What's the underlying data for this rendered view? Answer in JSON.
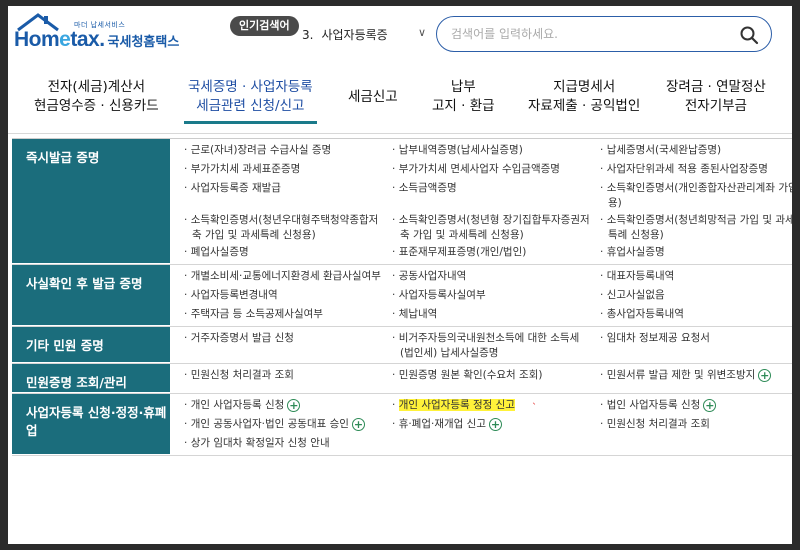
{
  "header": {
    "logo_tagline": "마더 납세서비스",
    "logo_home": "Hom",
    "logo_e": "e",
    "logo_tax": "tax.",
    "logo_kor": "국세청홈택스",
    "popular_label": "인기검색어",
    "popular_rank": "3.",
    "popular_term": "사업자등록증",
    "search_placeholder": "검색어를 입력하세요."
  },
  "nav": [
    {
      "line1": "전자(세금)계산서",
      "line2": "현금영수증 · 신용카드"
    },
    {
      "line1": "국세증명 · 사업자등록",
      "line2": "세금관련 신청/신고"
    },
    {
      "line1": "세금신고",
      "line2": ""
    },
    {
      "line1": "납부",
      "line2": "고지 · 환급"
    },
    {
      "line1": "지급명세서",
      "line2": "자료제출 · 공익법인"
    },
    {
      "line1": "장려금 · 연말정산",
      "line2": "전자기부금"
    }
  ],
  "sections": [
    {
      "title": "즉시발급 증명",
      "items": [
        "근로(자녀)장려금 수급사실 증명",
        "납부내역증명(납세사실증명)",
        "납세증명서(국세완납증명)",
        "부가가치세 과세표준증명",
        "부가가치세 면세사업자 수입금액증명",
        "사업자단위과세 적용 종된사업장증명",
        "사업자등록증 재발급",
        "소득금액증명",
        "소득확인증명서(개인종합자산관리계좌 가입용)",
        "소득확인증명서(청년우대형주택청약종합저축 가입 및 과세특례 신청용)",
        "소득확인증명서(청년형 장기집합투자증권저축 가입 및 과세특례 신청용)",
        "소득확인증명서(청년희망적금 가입 및 과세특례 신청용)",
        "폐업사실증명",
        "표준재무제표증명(개인/법인)",
        "휴업사실증명"
      ]
    },
    {
      "title": "사실확인 후 발급 증명",
      "items": [
        "개별소비세·교통에너지환경세 환급사실여부",
        "공동사업자내역",
        "대표자등록내역",
        "사업자등록변경내역",
        "사업자등록사실여부",
        "신고사실없음",
        "주택자금 등 소득공제사실여부",
        "체납내역",
        "총사업자등록내역"
      ]
    },
    {
      "title": "기타 민원 증명",
      "items": [
        "거주자증명서 발급 신청",
        "비거주자등의국내원천소득에 대한 소득세(법인세) 납세사실증명",
        "임대차 정보제공 요청서"
      ]
    },
    {
      "title": "민원증명 조회/관리",
      "items": [
        "민원신청 처리결과 조회",
        "민원증명 원본 확인(수요처 조회)",
        "민원서류 발급 제한 및 위변조방지"
      ]
    },
    {
      "title": "사업자등록 신청·정정·휴폐업",
      "items": [
        "개인 사업자등록 신청",
        "개인 사업자등록 정정 신고",
        "법인 사업자등록 신청",
        "개인 공동사업자·법인 공동대표 승인",
        "휴·폐업·재개업 신고",
        "민원신청 처리결과 조회",
        "상가 임대차 확정일자 신청 안내"
      ]
    }
  ],
  "colors": {
    "category_bg": "#1b6d7c",
    "brand_blue": "#1a5ba8",
    "highlight": "#fff23a",
    "plus_green": "#2e8b57"
  }
}
